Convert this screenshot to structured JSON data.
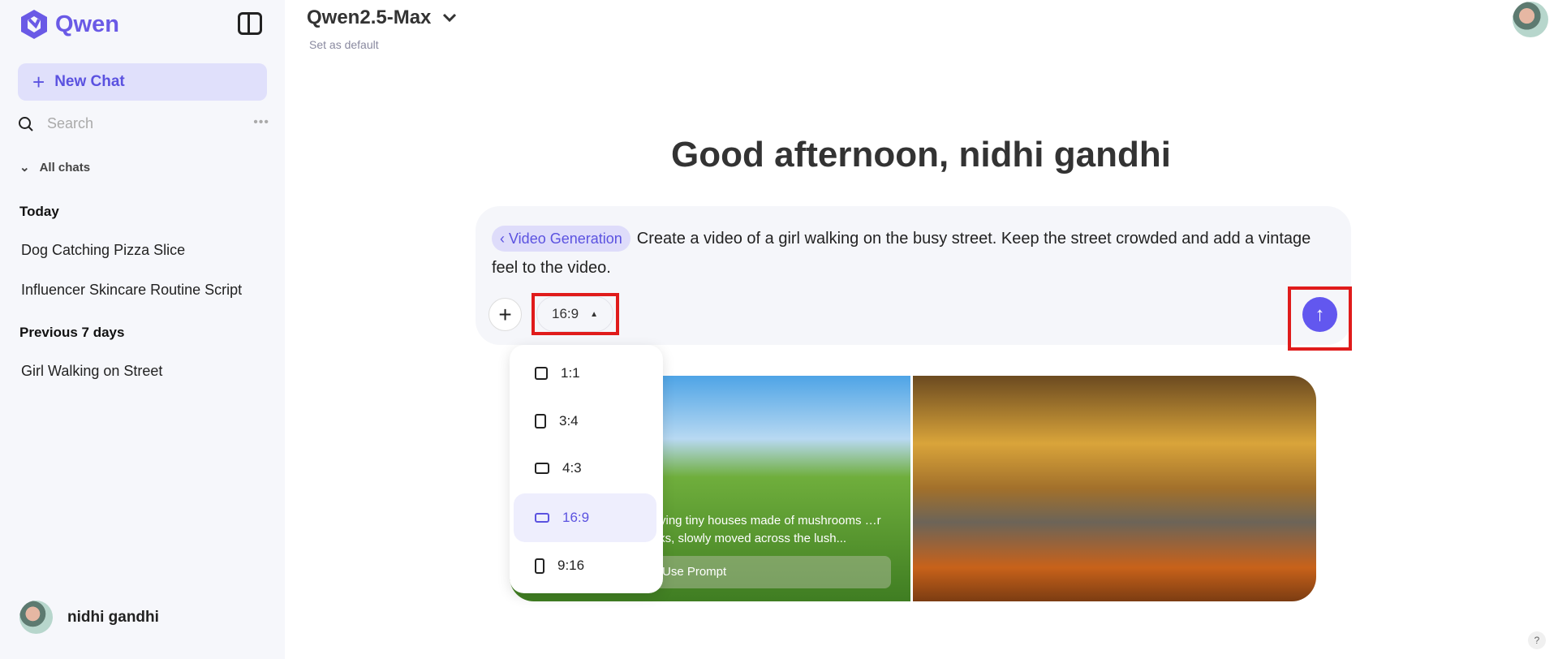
{
  "sidebar": {
    "logo": "Qwen",
    "new_chat": "New Chat",
    "search_placeholder": "Search",
    "all_chats": "All chats",
    "sections": [
      {
        "title": "Today",
        "items": [
          "Dog Catching Pizza Slice",
          "Influencer Skincare Routine Script"
        ]
      },
      {
        "title": "Previous 7 days",
        "items": [
          "Girl Walking on Street"
        ]
      }
    ],
    "user": "nidhi gandhi"
  },
  "header": {
    "model": "Qwen2.5-Max",
    "set_default": "Set as default"
  },
  "greeting": "Good afternoon, nidhi gandhi",
  "input": {
    "mode_tag": "Video Generation",
    "text": "Create a video of a girl walking on the busy street. Keep the street crowded and add a vintage feel to the video.",
    "ratio": "16:9"
  },
  "dropdown": {
    "options": [
      "1:1",
      "3:4",
      "4:3",
      "16:9",
      "9:16"
    ],
    "selected": "16:9"
  },
  "examples": {
    "caption": "…rrying tiny houses made of mushrooms …r backs, slowly moved across the lush...",
    "use_prompt": "Use Prompt"
  },
  "help": "?",
  "colors": {
    "accent": "#6257ef",
    "highlight": "#e01b1b"
  }
}
